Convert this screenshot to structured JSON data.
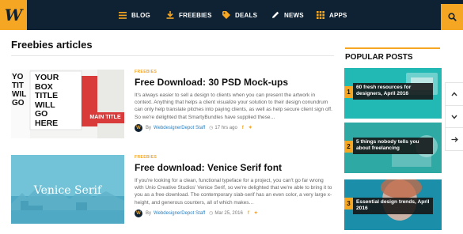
{
  "brand": {
    "logo_letter": "W",
    "accent": "#f5a623",
    "nav_bg": "#0e2233"
  },
  "nav": {
    "items": [
      {
        "label": "BLOG",
        "icon": "list-icon"
      },
      {
        "label": "FREEBIES",
        "icon": "download-icon"
      },
      {
        "label": "DEALS",
        "icon": "tag-icon"
      },
      {
        "label": "NEWS",
        "icon": "pencil-icon"
      },
      {
        "label": "APPS",
        "icon": "grid-icon"
      }
    ],
    "search_icon": "search-icon"
  },
  "main": {
    "title": "Freebies articles",
    "articles": [
      {
        "category": "FREEBIES",
        "headline": "Free Download: 30 PSD Mock-ups",
        "excerpt": "It's always easier to sell a design to clients when you can present the artwork in context. Anything that helps a client visualize your solution to their design conundrum can only help translate pitches into paying clients, as well as help secure client sign off. So we're delighted that SmartyBundles have supplied these…",
        "by": "By",
        "author": "WebdesignerDepot Staff",
        "time": "17 hrs ago",
        "thumb_words": [
          "YOUR",
          "BOX",
          "TITLE",
          "WILL",
          "GO",
          "HERE"
        ],
        "thumb_left_words": [
          "YO",
          "TIT",
          "WIL",
          "GO"
        ],
        "thumb_badge": "MAIN TITLE"
      },
      {
        "category": "FREEBIES",
        "headline": "Free download: Venice Serif font",
        "excerpt": "If you're looking for a clean, functional typeface for a project, you can't go far wrong with Unio Creative Studios' Venice Serif, so we're delighted that we're able to bring it to you as a free download. The contemporary slab-serif has an even color, a very large x-height, and generous counters, all of which makes…",
        "by": "By",
        "author": "WebdesignerDepot Staff",
        "time": "Mar 25, 2016",
        "thumb_text": "Venice Serif"
      }
    ]
  },
  "sidebar": {
    "title": "POPULAR POSTS",
    "posts": [
      {
        "number": "1",
        "title": "60 fresh resources for designers, April 2016"
      },
      {
        "number": "2",
        "title": "5 things nobody tells you about freelancing"
      },
      {
        "number": "3",
        "title": "Essential design trends, April 2016"
      }
    ]
  },
  "share_rail": {
    "icons": [
      "chevron-up-icon",
      "chevron-down-icon",
      "arrow-right-icon"
    ]
  }
}
